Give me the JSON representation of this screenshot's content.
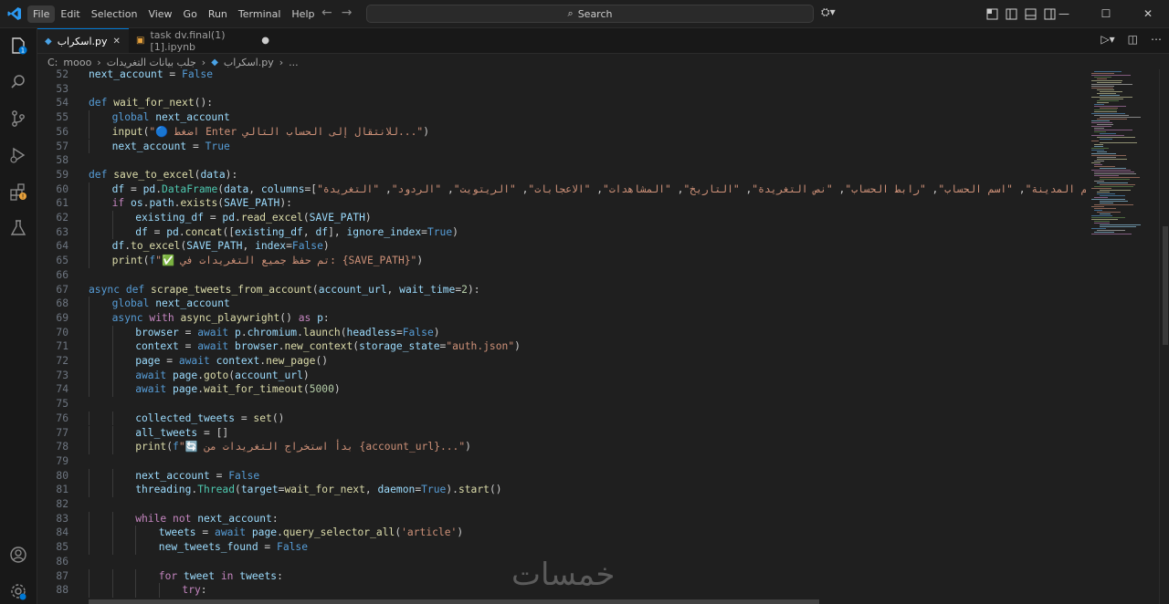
{
  "menu": [
    "File",
    "Edit",
    "Selection",
    "View",
    "Go",
    "Run",
    "Terminal",
    "Help"
  ],
  "search": {
    "label": "Search"
  },
  "tabs": [
    {
      "label": "اسكراب.py",
      "active": true
    },
    {
      "label": "task dv.final(1)[1].ipynb",
      "active": false
    }
  ],
  "breadcrumb": [
    "C:",
    "mooo",
    "جلب بيانات التغريدات",
    "اسكراب.py",
    "..."
  ],
  "code_lines": [
    {
      "n": "52",
      "indent": 0,
      "text": "next_account = False"
    },
    {
      "n": "53",
      "indent": 0,
      "text": ""
    },
    {
      "n": "54",
      "indent": 0,
      "text": "def wait_for_next():"
    },
    {
      "n": "55",
      "indent": 1,
      "text": "global next_account"
    },
    {
      "n": "56",
      "indent": 1,
      "text": "input(\"🔵 اضغط Enter للانتقال إلى الحساب التالي...\")"
    },
    {
      "n": "57",
      "indent": 1,
      "text": "next_account = True"
    },
    {
      "n": "58",
      "indent": 0,
      "text": ""
    },
    {
      "n": "59",
      "indent": 0,
      "text": "def save_to_excel(data):"
    },
    {
      "n": "60",
      "indent": 1,
      "text": "df = pd.DataFrame(data, columns=[\"اسم المدينة\", \"اسم الحساب\", \"رابط الحساب\", \"نص التغريدة\", \"التاريخ\", \"المشاهدات\", \"الاعجابات\", \"الريتويت\", \"الردود\", \"التغريدة"
    },
    {
      "n": "61",
      "indent": 1,
      "text": "if os.path.exists(SAVE_PATH):"
    },
    {
      "n": "62",
      "indent": 2,
      "text": "existing_df = pd.read_excel(SAVE_PATH)"
    },
    {
      "n": "63",
      "indent": 2,
      "text": "df = pd.concat([existing_df, df], ignore_index=True)"
    },
    {
      "n": "64",
      "indent": 1,
      "text": "df.to_excel(SAVE_PATH, index=False)"
    },
    {
      "n": "65",
      "indent": 1,
      "text": "print(f\"✅ تم حفظ جميع التغريدات في: {SAVE_PATH}\")"
    },
    {
      "n": "66",
      "indent": 0,
      "text": ""
    },
    {
      "n": "67",
      "indent": 0,
      "text": "async def scrape_tweets_from_account(account_url, wait_time=2):"
    },
    {
      "n": "68",
      "indent": 1,
      "text": "global next_account"
    },
    {
      "n": "69",
      "indent": 1,
      "text": "async with async_playwright() as p:"
    },
    {
      "n": "70",
      "indent": 2,
      "text": "browser = await p.chromium.launch(headless=False)"
    },
    {
      "n": "71",
      "indent": 2,
      "text": "context = await browser.new_context(storage_state=\"auth.json\")"
    },
    {
      "n": "72",
      "indent": 2,
      "text": "page = await context.new_page()"
    },
    {
      "n": "73",
      "indent": 2,
      "text": "await page.goto(account_url)"
    },
    {
      "n": "74",
      "indent": 2,
      "text": "await page.wait_for_timeout(5000)"
    },
    {
      "n": "75",
      "indent": 0,
      "text": ""
    },
    {
      "n": "76",
      "indent": 2,
      "text": "collected_tweets = set()"
    },
    {
      "n": "77",
      "indent": 2,
      "text": "all_tweets = []"
    },
    {
      "n": "78",
      "indent": 2,
      "text": "print(f\"🔄 بدأ استخراج التغريدات من {account_url}...\")"
    },
    {
      "n": "79",
      "indent": 0,
      "text": ""
    },
    {
      "n": "80",
      "indent": 2,
      "text": "next_account = False"
    },
    {
      "n": "81",
      "indent": 2,
      "text": "threading.Thread(target=wait_for_next, daemon=True).start()"
    },
    {
      "n": "82",
      "indent": 0,
      "text": ""
    },
    {
      "n": "83",
      "indent": 2,
      "text": "while not next_account:"
    },
    {
      "n": "84",
      "indent": 3,
      "text": "tweets = await page.query_selector_all('article')"
    },
    {
      "n": "85",
      "indent": 3,
      "text": "new_tweets_found = False"
    },
    {
      "n": "86",
      "indent": 0,
      "text": ""
    },
    {
      "n": "87",
      "indent": 3,
      "text": "for tweet in tweets:"
    },
    {
      "n": "88",
      "indent": 4,
      "text": "try:"
    }
  ],
  "watermark": "خمسات",
  "colors": {
    "accent": "#0078d4",
    "bg": "#1f1f1f",
    "sidebar": "#181818"
  },
  "icons": [
    "vscode-logo-icon",
    "explorer-icon",
    "search-icon",
    "source-control-icon",
    "run-debug-icon",
    "extensions-icon",
    "testing-icon",
    "account-icon",
    "settings-gear-icon",
    "run-icon",
    "split-editor-icon",
    "more-actions-icon"
  ]
}
